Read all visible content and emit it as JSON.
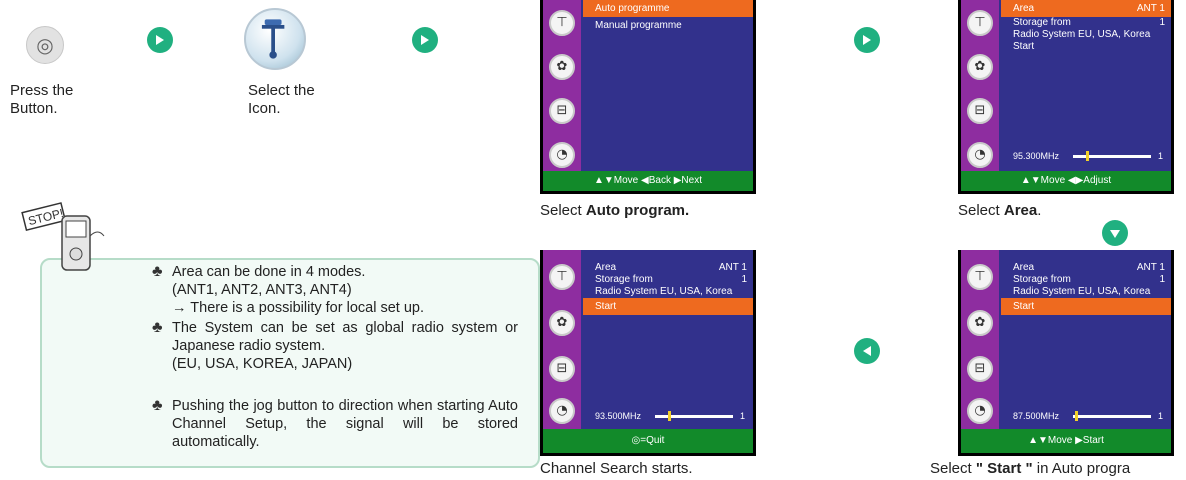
{
  "steps": {
    "press_label": "Press the Button.",
    "select_icon_label": "Select the Icon.",
    "button_glyph": "◎"
  },
  "notes": [
    {
      "text": "Area can be done in 4 modes.",
      "sub": "(ANT1, ANT2, ANT3, ANT4)",
      "sub2": "→ There is a possibility for local set up."
    },
    {
      "text": "The System can be set as global radio system or Japanese radio system.",
      "sub": "(EU, USA, KOREA, JAPAN)"
    },
    {
      "text": "Pushing the jog button to direction when starting Auto Channel Setup, the signal will be stored automatically."
    }
  ],
  "stop_label": "STOP!",
  "screens": {
    "s1": {
      "rows": [
        {
          "label": "Auto programme",
          "value": ""
        },
        {
          "label": "Manual programme",
          "value": ""
        }
      ],
      "footer": "▲▼Move ◀Back ▶Next",
      "caption_pre": "Select ",
      "caption_bold": "Auto program.",
      "caption_post": ""
    },
    "s2": {
      "rows": [
        {
          "label": "Area",
          "value": "ANT 1"
        },
        {
          "label": "Storage from",
          "value": "1"
        },
        {
          "label": "Radio System  EU, USA, Korea",
          "value": ""
        },
        {
          "label": "Start",
          "value": ""
        }
      ],
      "freq": "95.300MHz",
      "freq_end": "1",
      "footer": "▲▼Move ◀▶Adjust",
      "caption_pre": "Select ",
      "caption_bold": "Area",
      "caption_post": "."
    },
    "s3": {
      "rows": [
        {
          "label": "Area",
          "value": "ANT 1"
        },
        {
          "label": "Storage from",
          "value": "1"
        },
        {
          "label": "Radio System  EU, USA, Korea",
          "value": ""
        },
        {
          "label": "Start",
          "value": ""
        }
      ],
      "freq": "93.500MHz",
      "freq_end": "1",
      "footer": "◎=Quit",
      "caption": "Channel Search starts."
    },
    "s4": {
      "rows": [
        {
          "label": "Area",
          "value": "ANT 1"
        },
        {
          "label": "Storage from",
          "value": "1"
        },
        {
          "label": "Radio System  EU, USA, Korea",
          "value": ""
        },
        {
          "label": "Start",
          "value": ""
        }
      ],
      "freq": "87.500MHz",
      "freq_end": "1",
      "footer": "▲▼Move ▶Start",
      "caption_pre": "Select ",
      "caption_bold": "\" Start \"",
      "caption_post": " in Auto progra"
    }
  },
  "colors": {
    "accent": "#20b080",
    "panel": "#32318c",
    "highlight": "#ee6a1f",
    "footer": "#128a2a",
    "sidebar": "#8e2da0"
  }
}
